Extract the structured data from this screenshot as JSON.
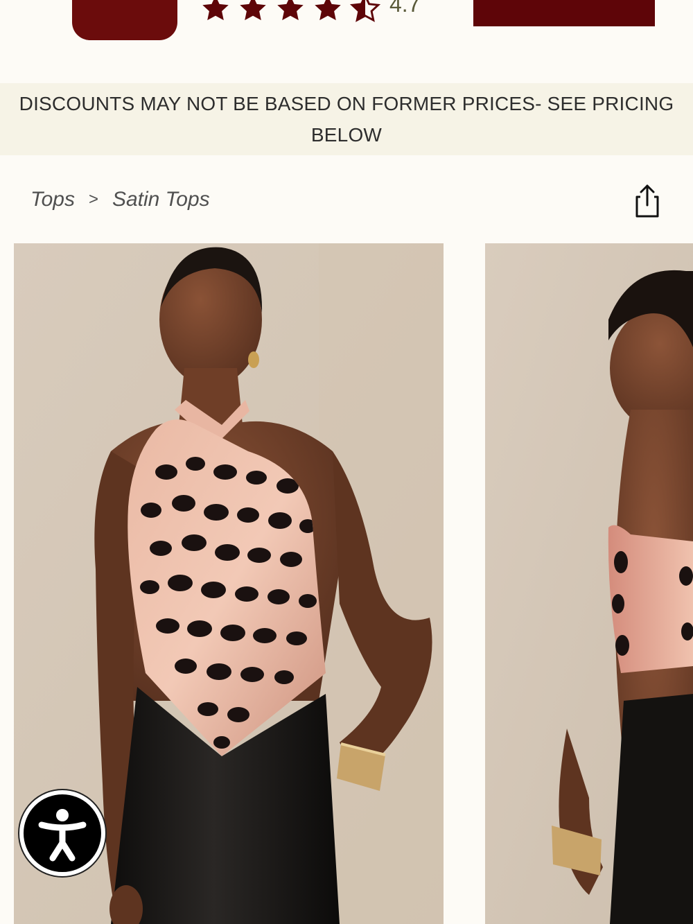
{
  "app_banner": {
    "rating": "4.7",
    "star_count": 4.5,
    "brand_color": "#6b0c0c",
    "icon": "app-logo-icon"
  },
  "notice": {
    "text": "DISCOUNTS MAY NOT BE BASED ON FORMER PRICES- SEE PRICING BELOW"
  },
  "breadcrumb": {
    "items": [
      "Tops",
      "Satin Tops"
    ],
    "separator": ">"
  },
  "share": {
    "icon": "share-icon"
  },
  "gallery": {
    "images": [
      {
        "alt": "Model wearing leopard print satin halter top, front view"
      },
      {
        "alt": "Model wearing leopard print satin halter top, side view"
      }
    ]
  },
  "accessibility": {
    "icon": "accessibility-icon"
  }
}
